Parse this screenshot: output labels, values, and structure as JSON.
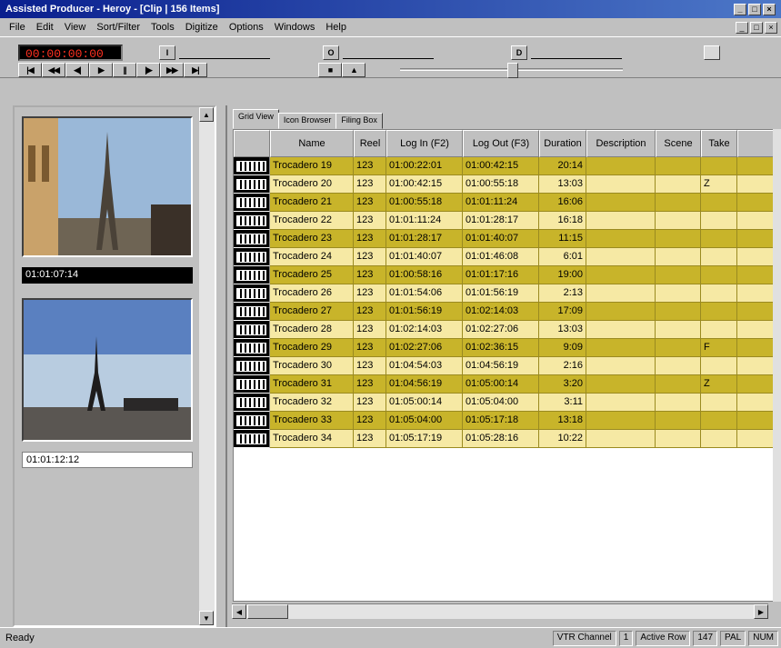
{
  "window": {
    "title": "Assisted Producer - Heroy - [Clip | 156 Items]"
  },
  "menu": [
    "File",
    "Edit",
    "View",
    "Sort/Filter",
    "Tools",
    "Digitize",
    "Options",
    "Windows",
    "Help"
  ],
  "timecode": {
    "display": "00:00:00:00",
    "in_mark": "I",
    "out_mark": "O",
    "dur_mark": "D"
  },
  "transport": [
    "|◀",
    "◀◀",
    "◀|",
    "▶",
    "||",
    "|▶",
    "▶▶",
    "▶|",
    "■",
    "▲"
  ],
  "preview": {
    "tc1": "01:01:07:14",
    "tc2": "01:01:12:12"
  },
  "tabs": [
    "Grid View",
    "Icon Browser",
    "Filing Box"
  ],
  "columns": [
    "Name",
    "Reel",
    "Log In (F2)",
    "Log Out (F3)",
    "Duration",
    "Description",
    "Scene",
    "Take"
  ],
  "rows": [
    [
      "Trocadero 19",
      "123",
      "01:00:22:01",
      "01:00:42:15",
      "20:14",
      "",
      ""
    ],
    [
      "Trocadero 20",
      "123",
      "01:00:42:15",
      "01:00:55:18",
      "13:03",
      "",
      "Z"
    ],
    [
      "Trocadero 21",
      "123",
      "01:00:55:18",
      "01:01:11:24",
      "16:06",
      "",
      ""
    ],
    [
      "Trocadero 22",
      "123",
      "01:01:11:24",
      "01:01:28:17",
      "16:18",
      "",
      ""
    ],
    [
      "Trocadero 23",
      "123",
      "01:01:28:17",
      "01:01:40:07",
      "11:15",
      "",
      ""
    ],
    [
      "Trocadero 24",
      "123",
      "01:01:40:07",
      "01:01:46:08",
      "6:01",
      "",
      ""
    ],
    [
      "Trocadero 25",
      "123",
      "01:00:58:16",
      "01:01:17:16",
      "19:00",
      "",
      ""
    ],
    [
      "Trocadero 26",
      "123",
      "01:01:54:06",
      "01:01:56:19",
      "2:13",
      "",
      ""
    ],
    [
      "Trocadero 27",
      "123",
      "01:01:56:19",
      "01:02:14:03",
      "17:09",
      "",
      ""
    ],
    [
      "Trocadero 28",
      "123",
      "01:02:14:03",
      "01:02:27:06",
      "13:03",
      "",
      ""
    ],
    [
      "Trocadero 29",
      "123",
      "01:02:27:06",
      "01:02:36:15",
      "9:09",
      "",
      "F"
    ],
    [
      "Trocadero 30",
      "123",
      "01:04:54:03",
      "01:04:56:19",
      "2:16",
      "",
      ""
    ],
    [
      "Trocadero 31",
      "123",
      "01:04:56:19",
      "01:05:00:14",
      "3:20",
      "",
      "Z"
    ],
    [
      "Trocadero 32",
      "123",
      "01:05:00:14",
      "01:05:04:00",
      "3:11",
      "",
      ""
    ],
    [
      "Trocadero 33",
      "123",
      "01:05:04:00",
      "01:05:17:18",
      "13:18",
      "",
      ""
    ],
    [
      "Trocadero 34",
      "123",
      "01:05:17:19",
      "01:05:28:16",
      "10:22",
      "",
      ""
    ]
  ],
  "status": {
    "ready": "Ready",
    "vtr_label": "VTR Channel",
    "vtr_value": "1",
    "active_label": "Active Row",
    "active_value": "147",
    "mode": "PAL",
    "num": "NUM"
  },
  "colors": {
    "row_dark": "#c8b42a",
    "row_light": "#f6e9a4",
    "titlebar": "#0a1f8e"
  }
}
